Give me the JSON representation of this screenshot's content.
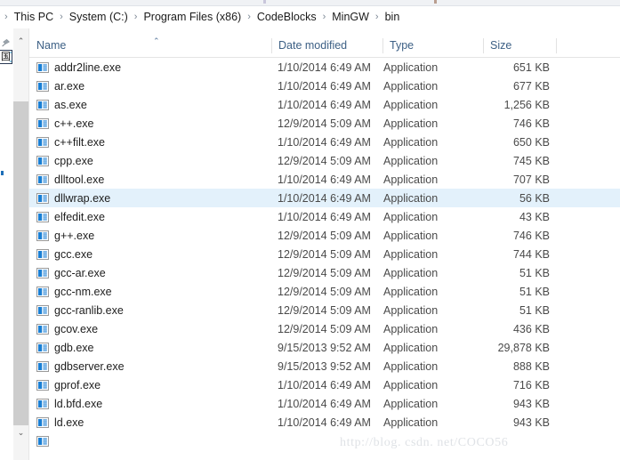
{
  "window": {
    "ribbon_ticks": [
      "#8a7fb5",
      "#9fa6ad",
      "#c0b0a0",
      "#8fa3bb"
    ]
  },
  "breadcrumb": {
    "leading_separator": "›",
    "separator": "›",
    "items": [
      {
        "label": "This PC"
      },
      {
        "label": "System (C:)"
      },
      {
        "label": "Program Files (x86)"
      },
      {
        "label": "CodeBlocks"
      },
      {
        "label": "MinGW"
      },
      {
        "label": "bin"
      }
    ]
  },
  "navpane": {
    "pin_icon": "pin-icon",
    "partial_item_label": "国"
  },
  "scrollbar": {
    "up_arrow": "⌃",
    "down_arrow": "⌄"
  },
  "columns": {
    "name": "Name",
    "date_modified": "Date modified",
    "type": "Type",
    "size": "Size",
    "sort_indicator": "⌃"
  },
  "files": [
    {
      "name": "addr2line.exe",
      "icon": "application-exe-icon",
      "date": "1/10/2014 6:49 AM",
      "type": "Application",
      "size": "651 KB",
      "selected": false
    },
    {
      "name": "ar.exe",
      "icon": "application-exe-icon",
      "date": "1/10/2014 6:49 AM",
      "type": "Application",
      "size": "677 KB",
      "selected": false
    },
    {
      "name": "as.exe",
      "icon": "application-exe-icon",
      "date": "1/10/2014 6:49 AM",
      "type": "Application",
      "size": "1,256 KB",
      "selected": false
    },
    {
      "name": "c++.exe",
      "icon": "application-exe-icon",
      "date": "12/9/2014 5:09 AM",
      "type": "Application",
      "size": "746 KB",
      "selected": false
    },
    {
      "name": "c++filt.exe",
      "icon": "application-exe-icon",
      "date": "1/10/2014 6:49 AM",
      "type": "Application",
      "size": "650 KB",
      "selected": false
    },
    {
      "name": "cpp.exe",
      "icon": "application-exe-icon",
      "date": "12/9/2014 5:09 AM",
      "type": "Application",
      "size": "745 KB",
      "selected": false
    },
    {
      "name": "dlltool.exe",
      "icon": "application-exe-icon",
      "date": "1/10/2014 6:49 AM",
      "type": "Application",
      "size": "707 KB",
      "selected": false
    },
    {
      "name": "dllwrap.exe",
      "icon": "application-exe-icon",
      "date": "1/10/2014 6:49 AM",
      "type": "Application",
      "size": "56 KB",
      "selected": true
    },
    {
      "name": "elfedit.exe",
      "icon": "application-exe-icon",
      "date": "1/10/2014 6:49 AM",
      "type": "Application",
      "size": "43 KB",
      "selected": false
    },
    {
      "name": "g++.exe",
      "icon": "application-exe-icon",
      "date": "12/9/2014 5:09 AM",
      "type": "Application",
      "size": "746 KB",
      "selected": false
    },
    {
      "name": "gcc.exe",
      "icon": "application-exe-icon",
      "date": "12/9/2014 5:09 AM",
      "type": "Application",
      "size": "744 KB",
      "selected": false
    },
    {
      "name": "gcc-ar.exe",
      "icon": "application-exe-icon",
      "date": "12/9/2014 5:09 AM",
      "type": "Application",
      "size": "51 KB",
      "selected": false
    },
    {
      "name": "gcc-nm.exe",
      "icon": "application-exe-icon",
      "date": "12/9/2014 5:09 AM",
      "type": "Application",
      "size": "51 KB",
      "selected": false
    },
    {
      "name": "gcc-ranlib.exe",
      "icon": "application-exe-icon",
      "date": "12/9/2014 5:09 AM",
      "type": "Application",
      "size": "51 KB",
      "selected": false
    },
    {
      "name": "gcov.exe",
      "icon": "application-exe-icon",
      "date": "12/9/2014 5:09 AM",
      "type": "Application",
      "size": "436 KB",
      "selected": false
    },
    {
      "name": "gdb.exe",
      "icon": "application-exe-icon",
      "date": "9/15/2013 9:52 AM",
      "type": "Application",
      "size": "29,878 KB",
      "selected": false
    },
    {
      "name": "gdbserver.exe",
      "icon": "application-exe-icon",
      "date": "9/15/2013 9:52 AM",
      "type": "Application",
      "size": "888 KB",
      "selected": false
    },
    {
      "name": "gprof.exe",
      "icon": "application-exe-icon",
      "date": "1/10/2014 6:49 AM",
      "type": "Application",
      "size": "716 KB",
      "selected": false
    },
    {
      "name": "ld.bfd.exe",
      "icon": "application-exe-icon",
      "date": "1/10/2014 6:49 AM",
      "type": "Application",
      "size": "943 KB",
      "selected": false
    },
    {
      "name": "ld.exe",
      "icon": "application-exe-icon",
      "date": "1/10/2014 6:49 AM",
      "type": "Application",
      "size": "943 KB",
      "selected": false
    }
  ],
  "watermark": {
    "text": "http://blog. csdn. net/COCO56"
  },
  "colors": {
    "selection": "#e3f1fb",
    "header_text": "#3d6085",
    "icon_blue": "#1a7fd4",
    "scrollbar_thumb": "#cdcdcd"
  }
}
